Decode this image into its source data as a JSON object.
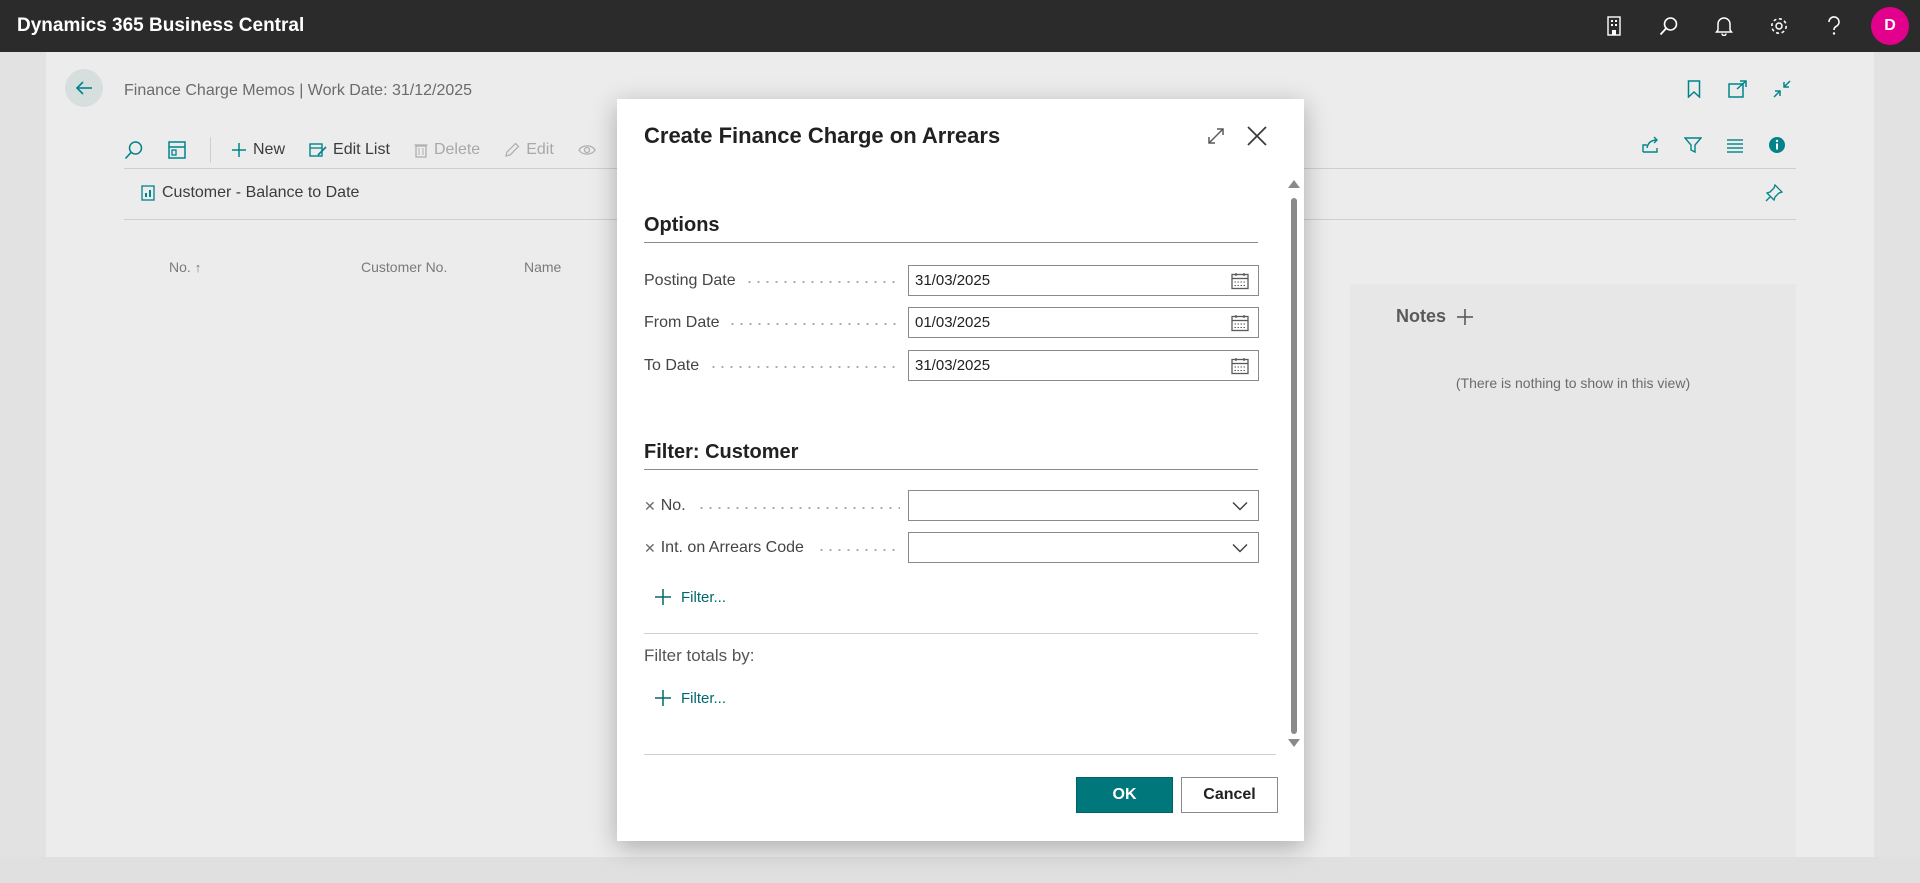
{
  "app": {
    "title": "Dynamics 365 Business Central",
    "avatar_initial": "D"
  },
  "page": {
    "caption": "Finance Charge Memos | Work Date: 31/12/2025",
    "actions": {
      "new": "New",
      "edit_list": "Edit List",
      "delete": "Delete",
      "edit": "Edit"
    },
    "report_link": "Customer - Balance to Date",
    "columns": {
      "no": "No.",
      "customer_no": "Customer No.",
      "name": "Name"
    },
    "notes": {
      "title": "Notes",
      "empty": "(There is nothing to show in this view)"
    }
  },
  "dialog": {
    "title": "Create Finance Charge on Arrears",
    "options": {
      "title": "Options",
      "fields": [
        {
          "label": "Posting Date",
          "value": "31/03/2025"
        },
        {
          "label": "From Date",
          "value": "01/03/2025"
        },
        {
          "label": "To Date",
          "value": "31/03/2025"
        }
      ]
    },
    "filter": {
      "title": "Filter: Customer",
      "fields": [
        {
          "label": "No.",
          "value": ""
        },
        {
          "label": "Int. on Arrears Code",
          "value": ""
        }
      ],
      "add_filter": "Filter..."
    },
    "totals": {
      "label": "Filter totals by:",
      "add_filter": "Filter..."
    },
    "ok": "OK",
    "cancel": "Cancel"
  },
  "colors": {
    "accent": "#00787b",
    "appbar": "#2b2b2b",
    "avatar": "#e3008c"
  }
}
